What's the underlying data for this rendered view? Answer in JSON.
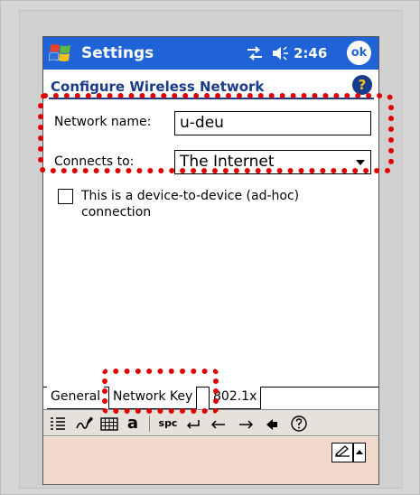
{
  "titlebar": {
    "app_title": "Settings",
    "time": "2:46",
    "ok_label": "ok"
  },
  "page": {
    "header": "Configure Wireless Network",
    "help_label": "?"
  },
  "form": {
    "network_name_label": "Network name:",
    "network_name_value": "u-deu",
    "connects_to_label": "Connects to:",
    "connects_to_value": "The Internet",
    "adhoc_label": "This is a device-to-device (ad-hoc) connection",
    "adhoc_checked": false
  },
  "tabs": [
    {
      "label": "General",
      "active": true
    },
    {
      "label": "Network Key",
      "active": false
    },
    {
      "label": "802.1x",
      "active": false
    }
  ],
  "sip_toolbar": {
    "buttons": [
      "list-icon",
      "handwriting-icon",
      "keyboard-icon",
      "a",
      "spc",
      "enter-icon",
      "left-arrow-icon",
      "right-arrow-icon",
      "backspace-icon",
      "help-circle-icon"
    ],
    "a_label": "a",
    "spc_label": "spc"
  },
  "colors": {
    "titlebar": "#1f63d6",
    "header_text": "#1a3b8c",
    "highlight": "#e00000",
    "menu_bar": "#efd9cb"
  }
}
